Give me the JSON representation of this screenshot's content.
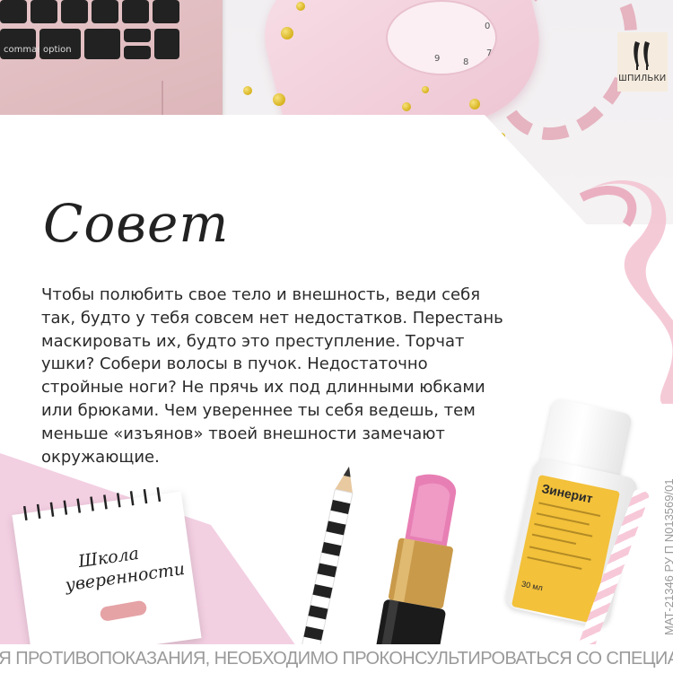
{
  "logo": {
    "text": "ШПИЛЬКИ"
  },
  "laptop": {
    "keys": [
      "command",
      "option"
    ]
  },
  "phone": {
    "dial_numbers": [
      "9",
      "8",
      "7",
      "0"
    ]
  },
  "heading": "Совет",
  "body_lines": [
    "Чтобы полюбить свое тело и внешность, веди себя",
    "так, будто у тебя совсем нет недостатков. Перестань",
    "маскировать их, будто это преступление. Торчат",
    "ушки? Собери волосы в пучок. Недостаточно",
    "стройные ноги? Не прячь их под длинными юбками",
    "или брюками. Чем увереннее ты себя ведешь, тем",
    "меньше «изъянов» твоей внешности замечают",
    "окружающие."
  ],
  "notepad": {
    "line1": "Школа",
    "line2": "уверенности"
  },
  "product": {
    "name": "Зинерит",
    "volume": "30 мл"
  },
  "registration_code": "МАТ-21346  РУ П N013569/01",
  "disclaimer": "ИМЕЮТСЯ ПРОТИВОПОКАЗАНИЯ, НЕОБХОДИМО ПРОКОНСУЛЬТИРОВАТЬСЯ СО СПЕЦИАЛИСТОМ",
  "colors": {
    "pink": "#f3cfe2",
    "gold": "#d7b21e",
    "text": "#2a2a2a",
    "disclaimer": "#9a9a9a"
  }
}
